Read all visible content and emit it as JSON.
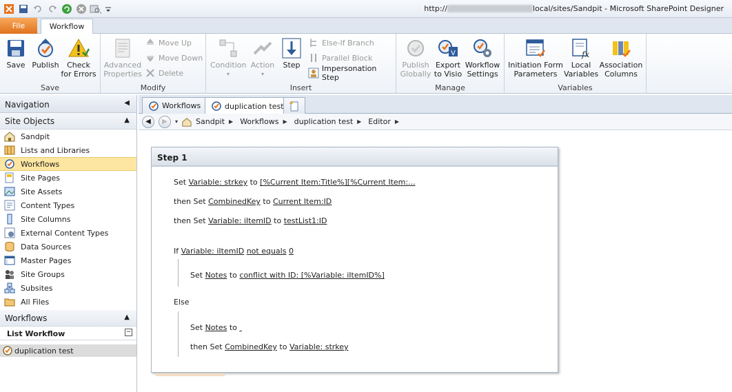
{
  "titlebar": {
    "url_prefix": "http://",
    "url_suffix": "local/sites/Sandpit",
    "separator": " - ",
    "app_name": "Microsoft SharePoint Designer"
  },
  "ribbon_tabs": {
    "file": "File",
    "workflow": "Workflow"
  },
  "ribbon": {
    "save_group": {
      "label": "Save",
      "save": "Save",
      "publish": "Publish",
      "check_line1": "Check",
      "check_line2": "for Errors"
    },
    "modify_group": {
      "label": "Modify",
      "adv_line1": "Advanced",
      "adv_line2": "Properties",
      "move_up": "Move Up",
      "move_down": "Move Down",
      "delete": "Delete"
    },
    "insert_group": {
      "label": "Insert",
      "condition": "Condition",
      "action": "Action",
      "step": "Step",
      "else_if": "Else-If Branch",
      "parallel": "Parallel Block",
      "impersonation": "Impersonation Step"
    },
    "manage_group": {
      "label": "Manage",
      "pub_line1": "Publish",
      "pub_line2": "Globally",
      "exp_line1": "Export",
      "exp_line2": "to Visio",
      "wfs_line1": "Workflow",
      "wfs_line2": "Settings"
    },
    "variables_group": {
      "label": "Variables",
      "init_line1": "Initiation Form",
      "init_line2": "Parameters",
      "local_line1": "Local",
      "local_line2": "Variables",
      "assoc_line1": "Association",
      "assoc_line2": "Columns"
    }
  },
  "nav": {
    "header": "Navigation",
    "site_objects": "Site Objects",
    "items": [
      {
        "label": "Sandpit",
        "icon": "home-icon"
      },
      {
        "label": "Lists and Libraries",
        "icon": "lists-icon"
      },
      {
        "label": "Workflows",
        "icon": "workflow-icon"
      },
      {
        "label": "Site Pages",
        "icon": "pages-icon"
      },
      {
        "label": "Site Assets",
        "icon": "assets-icon"
      },
      {
        "label": "Content Types",
        "icon": "content-types-icon"
      },
      {
        "label": "Site Columns",
        "icon": "columns-icon"
      },
      {
        "label": "External Content Types",
        "icon": "external-icon"
      },
      {
        "label": "Data Sources",
        "icon": "data-sources-icon"
      },
      {
        "label": "Master Pages",
        "icon": "master-pages-icon"
      },
      {
        "label": "Site Groups",
        "icon": "groups-icon"
      },
      {
        "label": "Subsites",
        "icon": "subsites-icon"
      },
      {
        "label": "All Files",
        "icon": "folder-icon"
      }
    ],
    "workflows_section": "Workflows",
    "list_workflow": "List Workflow",
    "workflow_item": "duplication test"
  },
  "doc_tabs": {
    "workflows": "Workflows",
    "current": "duplication test"
  },
  "breadcrumb": [
    "Sandpit",
    "Workflows",
    "duplication test",
    "Editor"
  ],
  "editor": {
    "step_title": "Step 1",
    "l1": {
      "a": "Set ",
      "b": "Variable: strkey",
      "c": " to ",
      "d": "[%Current Item:Title%][%Current Item:..."
    },
    "l2": {
      "a": "then Set ",
      "b": "CombinedKey",
      "c": " to ",
      "d": "Current Item:ID"
    },
    "l3": {
      "a": "then Set ",
      "b": "Variable: iItemID",
      "c": " to ",
      "d": "testList1:ID"
    },
    "l4": {
      "a": "If ",
      "b": "Variable: iItemID",
      "c": " ",
      "d": "not equals",
      "e": " ",
      "f": "0"
    },
    "l5": {
      "a": "Set ",
      "b": "Notes",
      "c": " to ",
      "d": "conflict with ID: [%Variable: iItemID%]"
    },
    "l6": "Else",
    "l7": {
      "a": "Set ",
      "b": "Notes",
      "c": " to ",
      "d": " "
    },
    "l8": {
      "a": "then Set ",
      "b": "CombinedKey",
      "c": " to ",
      "d": "Variable: strkey"
    }
  }
}
